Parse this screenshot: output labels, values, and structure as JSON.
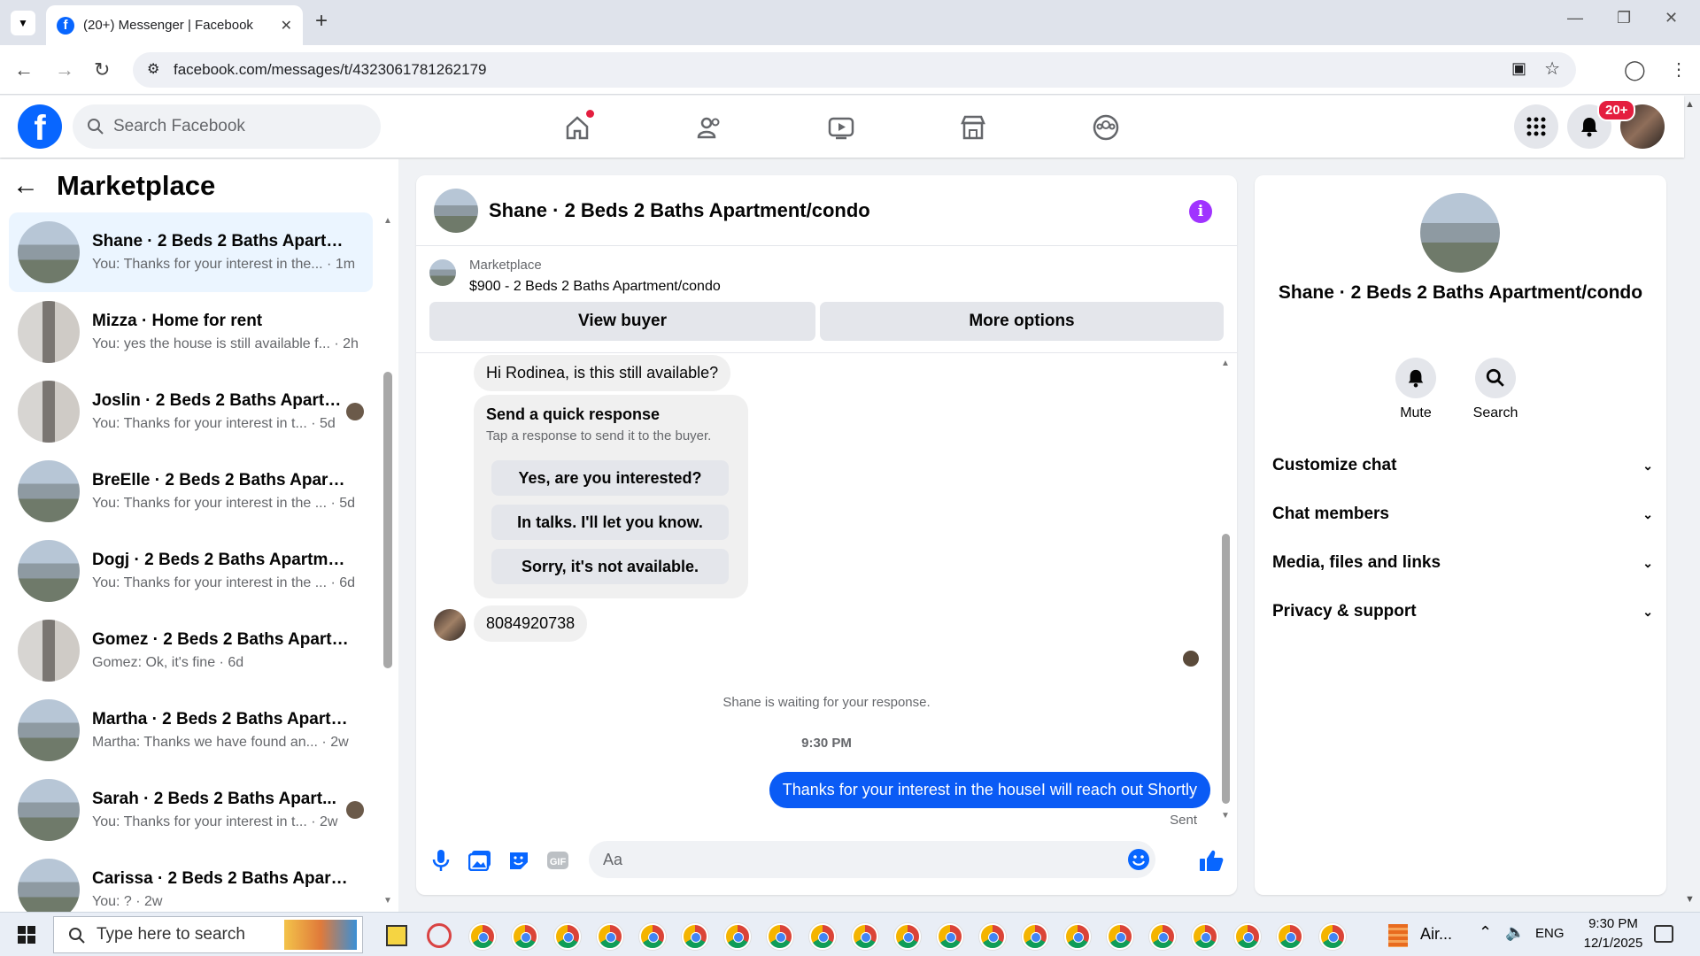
{
  "browser": {
    "tab_title": "(20+) Messenger | Facebook",
    "url": "facebook.com/messages/t/4323061781262179"
  },
  "fb": {
    "search_placeholder": "Search Facebook",
    "notif_badge": "20+"
  },
  "left": {
    "title": "Marketplace",
    "conversations": [
      {
        "name": "Shane · 2 Beds 2 Baths Apartme...",
        "preview": "You: Thanks for your interest in the...",
        "time": "1m",
        "thumb": "house"
      },
      {
        "name": "Mizza · Home for rent",
        "preview": "You: yes the house is still available f...",
        "time": "2h",
        "thumb": "interior"
      },
      {
        "name": "Joslin · 2 Beds 2 Baths Apartm...",
        "preview": "You: Thanks for your interest in t...",
        "time": "5d",
        "thumb": "interior"
      },
      {
        "name": "BreElle · 2 Beds 2 Baths Apartme...",
        "preview": "You: Thanks for your interest in the ...",
        "time": "5d",
        "thumb": "house"
      },
      {
        "name": "Dogj · 2 Beds 2 Baths Apartmen...",
        "preview": "You: Thanks for your interest in the ...",
        "time": "6d",
        "thumb": "house"
      },
      {
        "name": "Gomez · 2 Beds 2 Baths Apartm...",
        "preview": "Gomez: Ok, it's fine",
        "time": "6d",
        "thumb": "interior"
      },
      {
        "name": "Martha · 2 Beds 2 Baths Apartm...",
        "preview": "Martha: Thanks we have found an...",
        "time": "2w",
        "thumb": "house"
      },
      {
        "name": "Sarah · 2 Beds 2 Baths Apart...",
        "preview": "You: Thanks for your interest in t...",
        "time": "2w",
        "thumb": "house"
      },
      {
        "name": "Carissa · 2 Beds 2 Baths Apartm...",
        "preview": "You: ?",
        "time": "2w",
        "thumb": "house"
      }
    ]
  },
  "chat": {
    "title": "Shane · 2 Beds 2 Baths Apartment/condo",
    "marketplace_label": "Marketplace",
    "listing": "$900 - 2 Beds 2 Baths Apartment/condo",
    "view_buyer": "View buyer",
    "more_options": "More options",
    "incoming_question": "Hi Rodinea, is this still available?",
    "quick_title": "Send a quick response",
    "quick_sub": "Tap a response to send it to the buyer.",
    "quick_replies": [
      "Yes, are you interested?",
      "In talks. I'll let you know.",
      "Sorry, it's not available."
    ],
    "phone_msg": "8084920738",
    "waiting": "Shane is waiting for your response.",
    "timestamp": "9:30 PM",
    "sent_msg": "Thanks for your interest in the houseI will reach out Shortly",
    "sent_status": "Sent",
    "input_placeholder": "Aa"
  },
  "right": {
    "name": "Shane · 2 Beds 2 Baths Apartment/condo",
    "mute": "Mute",
    "search": "Search",
    "sections": [
      "Customize chat",
      "Chat members",
      "Media, files and links",
      "Privacy & support"
    ]
  },
  "taskbar": {
    "search_placeholder": "Type here to search",
    "tray_app": "Air...",
    "lang": "ENG",
    "time": "9:30 PM",
    "date": "12/1/2025"
  },
  "colors": {
    "accent": "#0866ff",
    "sent_bubble": "#0a5bf5",
    "info": "#a033ff",
    "badge": "#e41e3f"
  }
}
